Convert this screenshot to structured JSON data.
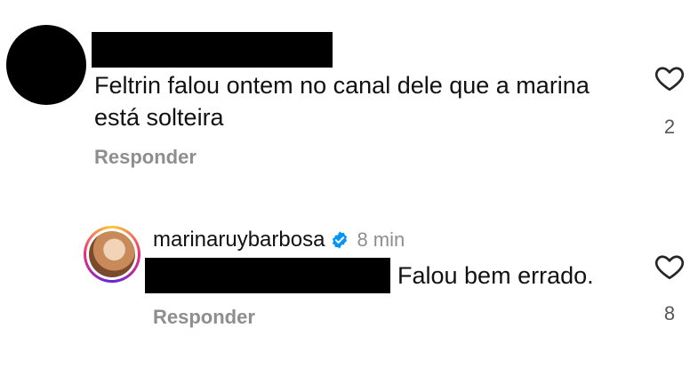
{
  "comments": [
    {
      "text": "Feltrin falou ontem no canal dele que a marina está solteira",
      "reply_label": "Responder",
      "like_count": "2",
      "like_icon": "heart-outline-icon"
    }
  ],
  "reply": {
    "username": "marinaruybarbosa",
    "verified_icon": "verified-badge-icon",
    "time": "8 min",
    "text": "Falou bem errado.",
    "reply_label": "Responder",
    "like_count": "8",
    "like_icon": "heart-outline-icon"
  },
  "colors": {
    "text": "#111111",
    "muted": "#8e8e8e",
    "verified": "#0095f6",
    "redaction": "#000000"
  }
}
